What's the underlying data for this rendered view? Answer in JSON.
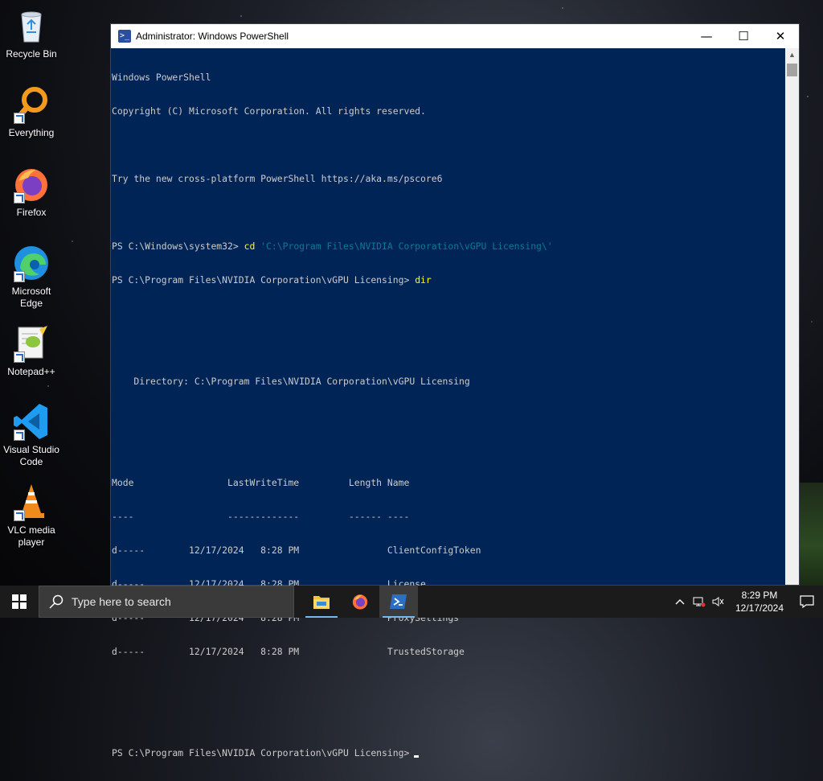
{
  "desktop": {
    "icons": [
      {
        "label": "Recycle Bin",
        "icon": "recycle-bin-icon"
      },
      {
        "label": "Everything",
        "icon": "everything-search-icon"
      },
      {
        "label": "Firefox",
        "icon": "firefox-icon"
      },
      {
        "label": "Microsoft Edge",
        "icon": "edge-icon"
      },
      {
        "label": "Notepad++",
        "icon": "notepadpp-icon"
      },
      {
        "label": "Visual Studio Code",
        "icon": "vscode-icon"
      },
      {
        "label": "VLC media player",
        "icon": "vlc-icon"
      }
    ]
  },
  "window": {
    "title": "Administrator: Windows PowerShell",
    "minimize": "—",
    "maximize": "☐",
    "close": "✕"
  },
  "console": {
    "lines": [
      "Windows PowerShell",
      "Copyright (C) Microsoft Corporation. All rights reserved.",
      "",
      "Try the new cross-platform PowerShell https://aka.ms/pscore6",
      "",
      "",
      "",
      "",
      "",
      "    Directory: C:\\Program Files\\NVIDIA Corporation\\vGPU Licensing",
      "",
      "",
      "Mode                 LastWriteTime         Length Name",
      "----                 -------------         ------ ----",
      "d-----        12/17/2024   8:28 PM                ClientConfigToken",
      "d-----        12/17/2024   8:28 PM                License",
      "d-----        12/17/2024   8:28 PM                ProxySettings",
      "d-----        12/17/2024   8:28 PM                TrustedStorage",
      "",
      "",
      ""
    ],
    "cmd1": {
      "prompt": "PS C:\\Windows\\system32> ",
      "command": "cd",
      "argument": " 'C:\\Program Files\\NVIDIA Corporation\\vGPU Licensing\\'"
    },
    "cmd2": {
      "prompt": "PS C:\\Program Files\\NVIDIA Corporation\\vGPU Licensing> ",
      "command": "dir"
    },
    "final_prompt": "PS C:\\Program Files\\NVIDIA Corporation\\vGPU Licensing>"
  },
  "taskbar": {
    "search_placeholder": "Type here to search",
    "apps": [
      "file-explorer-icon",
      "firefox-icon",
      "powershell-icon"
    ],
    "time": "8:29 PM",
    "date": "12/17/2024"
  },
  "colors": {
    "console_bg": "#012456",
    "console_fg": "#cccccc",
    "command": "#ffff00",
    "string": "#0b7a94",
    "taskbar": "#1b1b1b"
  }
}
